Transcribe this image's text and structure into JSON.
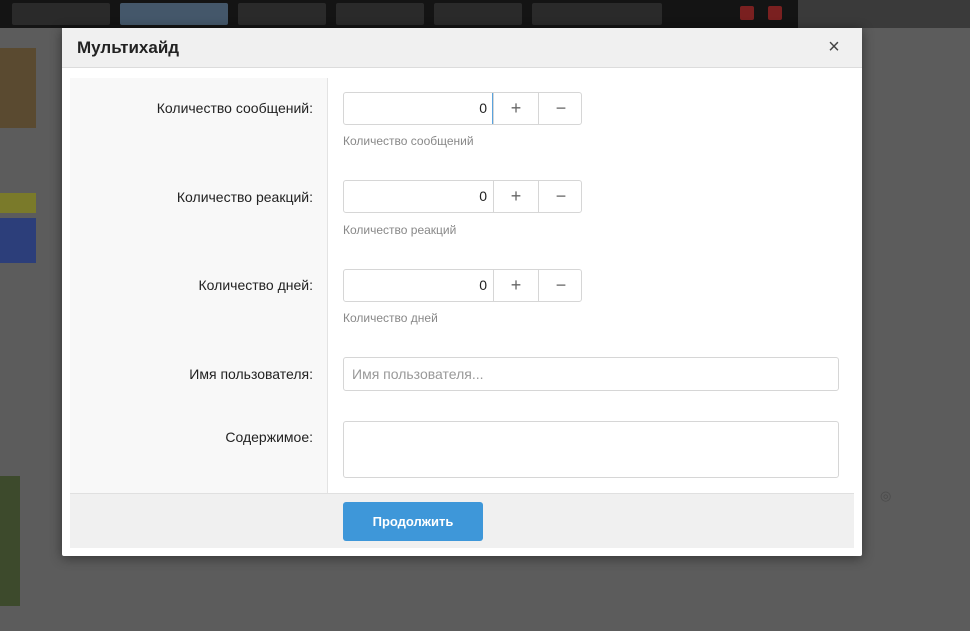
{
  "modal": {
    "title": "Мультихайд",
    "close_glyph": "×",
    "fields": [
      {
        "label": "Количество сообщений:",
        "value": "0",
        "hint": "Количество сообщений"
      },
      {
        "label": "Количество реакций:",
        "value": "0",
        "hint": "Количество реакций"
      },
      {
        "label": "Количество дней:",
        "value": "0",
        "hint": "Количество дней"
      }
    ],
    "stepper": {
      "plus": "+",
      "minus": "−"
    },
    "username": {
      "label": "Имя пользователя:",
      "placeholder": "Имя пользователя..."
    },
    "content": {
      "label": "Содержимое:"
    },
    "submit_label": "Продолжить"
  },
  "colors": {
    "accent": "#3e97d9",
    "overlay_dim": "#5c5c5c"
  },
  "icons": {
    "close": "close-icon",
    "plus": "plus-icon",
    "minus": "minus-icon"
  }
}
